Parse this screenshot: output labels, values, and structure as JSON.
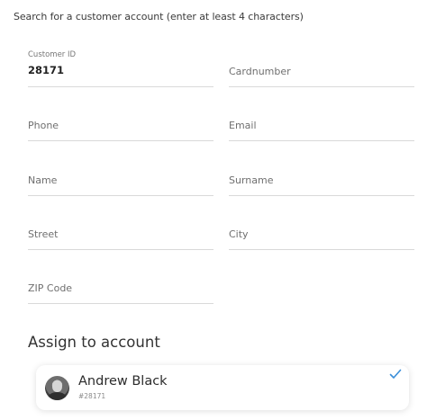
{
  "search": {
    "hint": "Search for a customer account (enter at least 4 characters)"
  },
  "fields": {
    "customer_id": {
      "label": "Customer ID",
      "value": "28171"
    },
    "cardnumber": {
      "placeholder": "Cardnumber"
    },
    "phone": {
      "placeholder": "Phone"
    },
    "email": {
      "placeholder": "Email"
    },
    "name": {
      "placeholder": "Name"
    },
    "surname": {
      "placeholder": "Surname"
    },
    "street": {
      "placeholder": "Street"
    },
    "city": {
      "placeholder": "City"
    },
    "zip": {
      "placeholder": "ZIP Code"
    }
  },
  "assign": {
    "title": "Assign to account",
    "account": {
      "name": "Andrew Black",
      "id": "#28171",
      "selected_icon": "check-icon",
      "check_color": "#3b8fd9"
    }
  }
}
